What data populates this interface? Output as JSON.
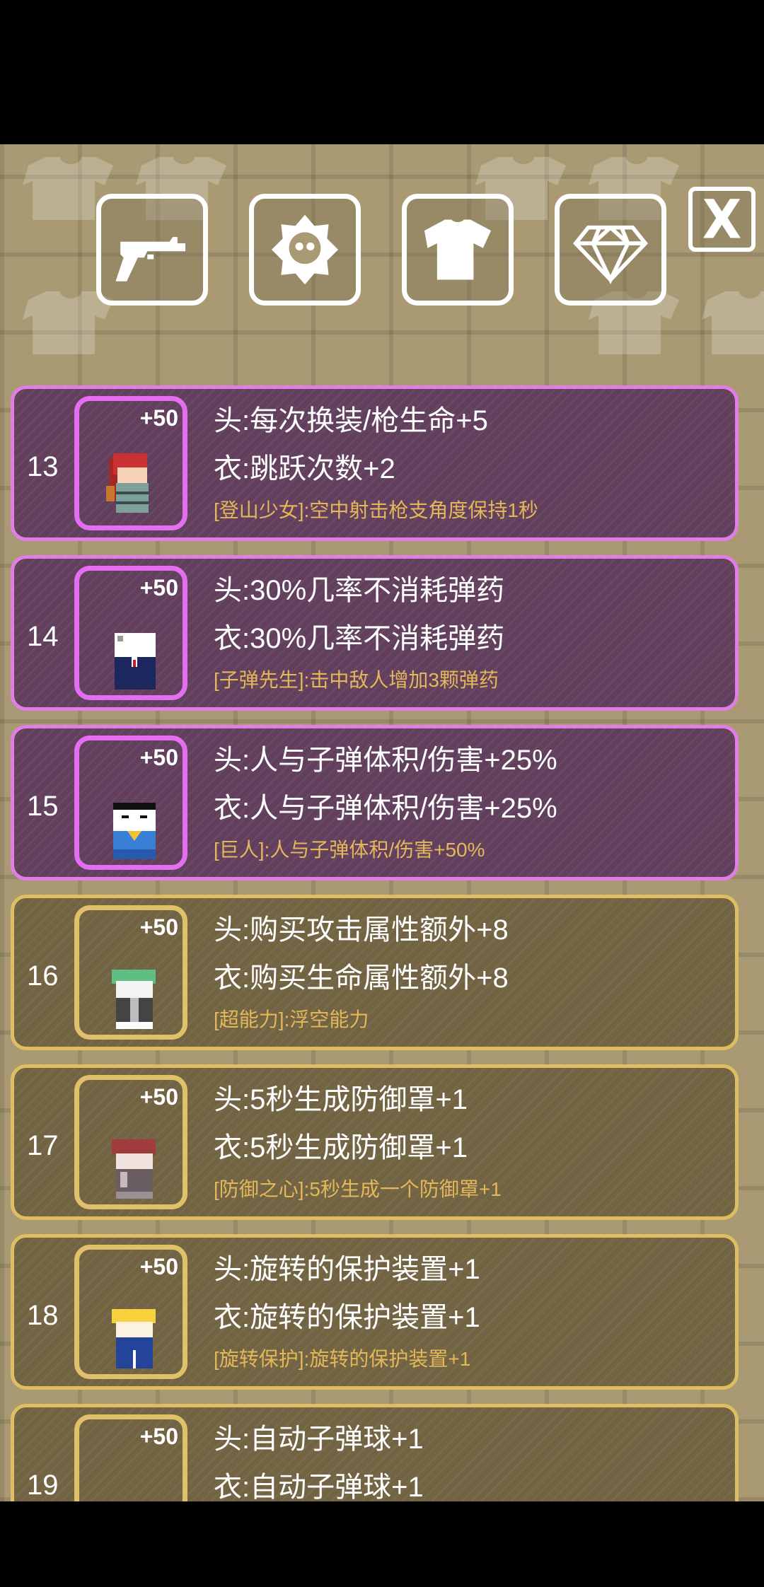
{
  "tabs": [
    {
      "name": "weapon",
      "icon": "revolver-icon"
    },
    {
      "name": "skill",
      "icon": "skull-badge-icon"
    },
    {
      "name": "costume",
      "icon": "shirt-icon"
    },
    {
      "name": "gem",
      "icon": "diamond-icon"
    }
  ],
  "close_label": "X",
  "colors": {
    "purple_border": "#e17de6",
    "gold_border": "#ddbe64",
    "skill_text": "#e4b85a",
    "background": "#a99a74"
  },
  "costumes": [
    {
      "num": "13",
      "bonus": "+50",
      "head": "头:每次换装/枪生命+5",
      "body": "衣:跳跃次数+2",
      "skill": "[登山少女]:空中射击枪支角度保持1秒",
      "rarity": "purple"
    },
    {
      "num": "14",
      "bonus": "+50",
      "head": "头:30%几率不消耗弹药",
      "body": "衣:30%几率不消耗弹药",
      "skill": "[子弹先生]:击中敌人增加3颗弹药",
      "rarity": "purple"
    },
    {
      "num": "15",
      "bonus": "+50",
      "head": "头:人与子弹体积/伤害+25%",
      "body": "衣:人与子弹体积/伤害+25%",
      "skill": "[巨人]:人与子弹体积/伤害+50%",
      "rarity": "purple"
    },
    {
      "num": "16",
      "bonus": "+50",
      "head": "头:购买攻击属性额外+8",
      "body": "衣:购买生命属性额外+8",
      "skill": "[超能力]:浮空能力",
      "rarity": "gold"
    },
    {
      "num": "17",
      "bonus": "+50",
      "head": "头:5秒生成防御罩+1",
      "body": "衣:5秒生成防御罩+1",
      "skill": "[防御之心]:5秒生成一个防御罩+1",
      "rarity": "gold"
    },
    {
      "num": "18",
      "bonus": "+50",
      "head": "头:旋转的保护装置+1",
      "body": "衣:旋转的保护装置+1",
      "skill": "[旋转保护]:旋转的保护装置+1",
      "rarity": "gold"
    },
    {
      "num": "19",
      "bonus": "+50",
      "head": "头:自动子弹球+1",
      "body": "衣:自动子弹球+1",
      "skill": "",
      "rarity": "gold"
    }
  ]
}
